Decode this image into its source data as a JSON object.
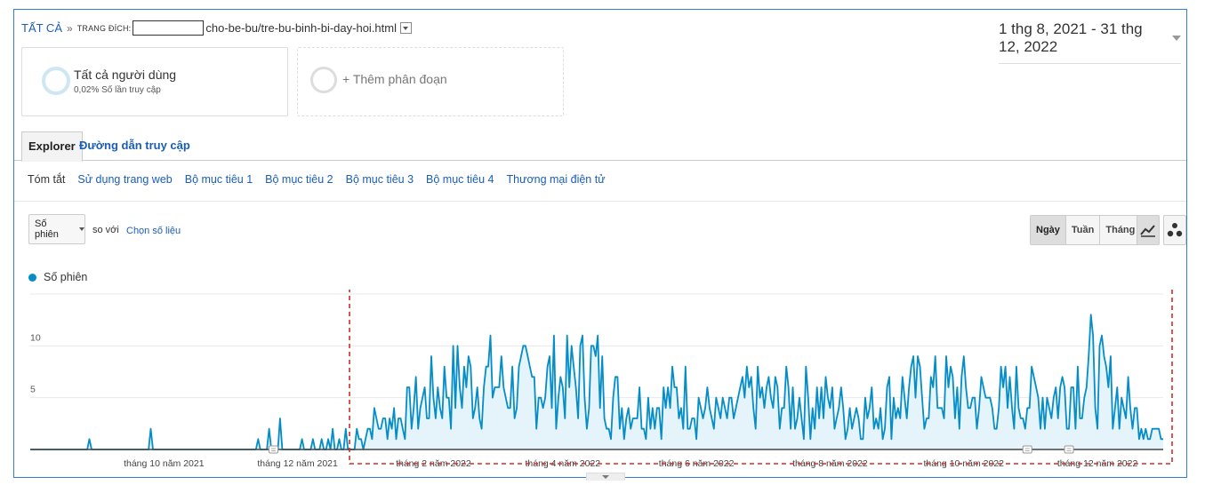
{
  "breadcrumb": {
    "all": "TẤT CẢ",
    "sep": "»",
    "label": "TRANG ĐÍCH:",
    "path": "cho-be-bu/tre-bu-binh-bi-day-hoi.html"
  },
  "date_range": "1 thg 8, 2021 - 31 thg 12, 2022",
  "segments": {
    "primary": {
      "title": "Tất cả người dùng",
      "subtitle": "0,02% Số lần truy cập"
    },
    "add": "+ Thêm phân đoạn"
  },
  "tabs": [
    {
      "label": "Explorer",
      "active": true
    },
    {
      "label": "Đường dẫn truy cập",
      "active": false
    }
  ],
  "subnav": [
    "Tóm tắt",
    "Sử dụng trang web",
    "Bộ mục tiêu 1",
    "Bộ mục tiêu 2",
    "Bộ mục tiêu 3",
    "Bộ mục tiêu 4",
    "Thương mại điện tử"
  ],
  "metric": {
    "selected": "Số phiên",
    "vs": "so với",
    "choose": "Chọn số liệu"
  },
  "granularity": [
    {
      "label": "Ngày",
      "active": true
    },
    {
      "label": "Tuần",
      "active": false
    },
    {
      "label": "Tháng",
      "active": false
    }
  ],
  "view_icons": [
    "line-chart-icon",
    "motion-chart-icon"
  ],
  "colors": {
    "series": "#058dc7",
    "fill": "#e5f3fa",
    "highlight": "#d22b2b",
    "link": "#1a5eb8"
  },
  "chart_data": {
    "type": "area",
    "x_start": "2021-08-01",
    "x_end": "2022-12-31",
    "ylim": [
      0,
      15
    ],
    "yticks": [
      "5",
      "10",
      "15"
    ],
    "xticks": [
      "tháng 10 năm 2021",
      "tháng 12 năm 2021",
      "tháng 2 năm 2022",
      "tháng 4 năm 2022",
      "tháng 6 năm 2022",
      "tháng 8 năm 2022",
      "tháng 10 năm 2022",
      "tháng 12 năm 2022"
    ],
    "series": [
      {
        "name": "Số phiên",
        "spikes": [
          {
            "date": "2021-08-28",
            "value": 1
          },
          {
            "date": "2021-09-25",
            "value": 2
          },
          {
            "date": "2021-11-13",
            "value": 1
          },
          {
            "date": "2021-11-18",
            "value": 2
          },
          {
            "date": "2021-11-23",
            "value": 3
          },
          {
            "date": "2021-12-03",
            "value": 1
          },
          {
            "date": "2021-12-08",
            "value": 1
          },
          {
            "date": "2021-12-12",
            "value": 1
          },
          {
            "date": "2021-12-15",
            "value": 1
          },
          {
            "date": "2021-12-17",
            "value": 2
          },
          {
            "date": "2021-12-20",
            "value": 1
          },
          {
            "date": "2021-12-23",
            "value": 2
          },
          {
            "date": "2021-12-28",
            "value": 2
          }
        ],
        "anchors": [
          {
            "date": "2022-01-10",
            "value": 4
          },
          {
            "date": "2022-02-05",
            "value": 10
          },
          {
            "date": "2022-02-20",
            "value": 12
          },
          {
            "date": "2022-03-10",
            "value": 10
          },
          {
            "date": "2022-03-25",
            "value": 11
          },
          {
            "date": "2022-04-10",
            "value": 12
          },
          {
            "date": "2022-04-15",
            "value": 14
          },
          {
            "date": "2022-04-22",
            "value": 8
          },
          {
            "date": "2022-05-10",
            "value": 7
          },
          {
            "date": "2022-05-26",
            "value": 9
          },
          {
            "date": "2022-06-15",
            "value": 5
          },
          {
            "date": "2022-06-25",
            "value": 8
          },
          {
            "date": "2022-07-25",
            "value": 8
          },
          {
            "date": "2022-08-15",
            "value": 6
          },
          {
            "date": "2022-09-05",
            "value": 9
          },
          {
            "date": "2022-09-12",
            "value": 10
          },
          {
            "date": "2022-10-15",
            "value": 8
          },
          {
            "date": "2022-11-12",
            "value": 9
          },
          {
            "date": "2022-11-28",
            "value": 13
          },
          {
            "date": "2022-12-20",
            "value": 5
          },
          {
            "date": "2022-12-31",
            "value": 2
          }
        ]
      }
    ],
    "grid": true,
    "annotations": [
      "2021-11-20",
      "2022-10-30",
      "2022-11-18"
    ],
    "highlight": {
      "from": "2022-01-01",
      "to": "2022-12-31"
    }
  }
}
